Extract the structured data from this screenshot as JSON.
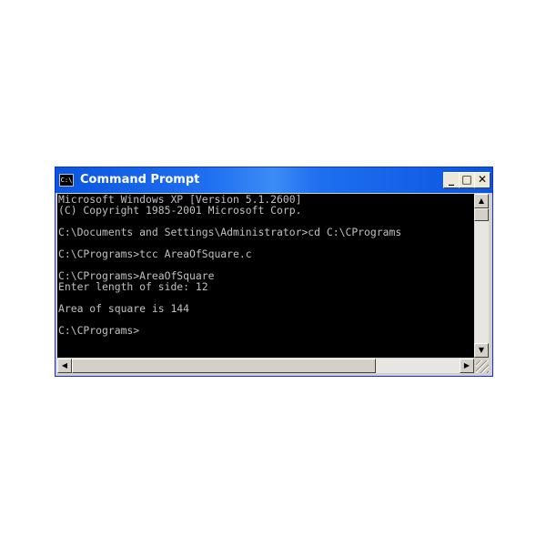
{
  "window": {
    "title": "Command Prompt",
    "icon_text": "C:\\",
    "icon": "console-icon",
    "controls": {
      "minimize": "_",
      "maximize": "□",
      "close": "✕"
    }
  },
  "console": {
    "background": "#000000",
    "foreground": "#c0c0c0",
    "lines": [
      "Microsoft Windows XP [Version 5.1.2600]",
      "(C) Copyright 1985-2001 Microsoft Corp.",
      "",
      "C:\\Documents and Settings\\Administrator>cd C:\\CPrograms",
      "",
      "C:\\CPrograms>tcc AreaOfSquare.c",
      "",
      "C:\\CPrograms>AreaOfSquare",
      "Enter length of side: 12",
      "",
      "Area of square is 144",
      "",
      "C:\\CPrograms>"
    ]
  },
  "scrollbars": {
    "up_arrow": "▲",
    "down_arrow": "▼",
    "left_arrow": "◀",
    "right_arrow": "▶"
  },
  "colors": {
    "titlebar": "#0a56e0",
    "frame": "#d4d0c8"
  }
}
